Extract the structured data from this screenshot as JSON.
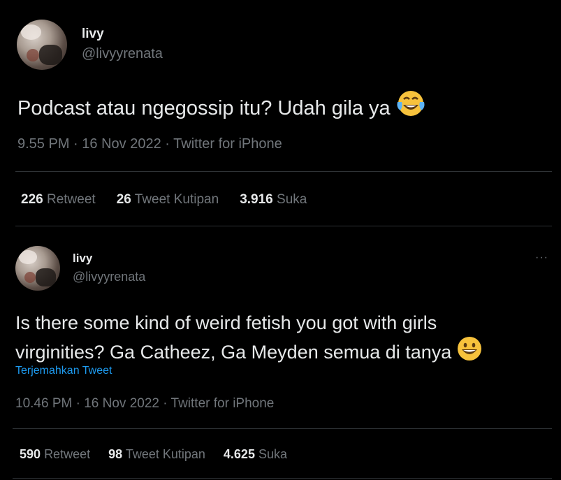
{
  "tweet1": {
    "name": "livy",
    "handle": "@livyyrenata",
    "text": "Podcast atau ngegossip itu? Udah gila ya",
    "emoji": "face-with-tears-of-joy",
    "time": "9.55 PM",
    "date": "16 Nov 2022",
    "source": "Twitter for iPhone",
    "retweets": "226",
    "retweets_label": "Retweet",
    "quotes": "26",
    "quotes_label": "Tweet Kutipan",
    "likes": "3.916",
    "likes_label": "Suka"
  },
  "tweet2": {
    "name": "livy",
    "handle": "@livyyrenata",
    "text_line1": "Is there some kind of weird fetish you got with girls",
    "text_line2": "virginities? Ga Catheez, Ga Meyden semua di tanya",
    "emoji": "grinning-face",
    "translate": "Terjemahkan Tweet",
    "time": "10.46 PM",
    "date": "16 Nov 2022",
    "source": "Twitter for iPhone",
    "retweets": "590",
    "retweets_label": "Retweet",
    "quotes": "98",
    "quotes_label": "Tweet Kutipan",
    "likes": "4.625",
    "likes_label": "Suka",
    "more": "···"
  },
  "separator": "·"
}
